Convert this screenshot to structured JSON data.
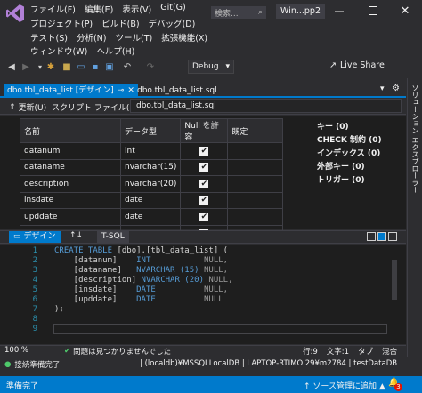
{
  "menu": {
    "row1": [
      "ファイル(F)",
      "編集(E)",
      "表示(V)",
      "Git(G)"
    ],
    "row2": [
      "プロジェクト(P)",
      "ビルド(B)",
      "デバッグ(D)"
    ],
    "row3": [
      "テスト(S)",
      "分析(N)",
      "ツール(T)",
      "拡張機能(X)"
    ],
    "row4": [
      "ウィンドウ(W)",
      "ヘルプ(H)"
    ]
  },
  "search": {
    "placeholder": "検索..."
  },
  "window": {
    "title": "Win...pp2"
  },
  "toolbar": {
    "configuration": "Debug",
    "live_share": "Live Share"
  },
  "tabs": {
    "design_tab": "dbo.tbl_data_list [デザイン]",
    "sql_tab": "dbo.tbl_data_list.sql",
    "right_strip": "ソリューション エクスプローラー"
  },
  "designer": {
    "update_label": "更新(U)",
    "script_file_label": "スクリプト ファイル(I):",
    "script_file_name": "dbo.tbl_data_list.sql"
  },
  "grid": {
    "headers": [
      "名前",
      "データ型",
      "Null を許容",
      "既定"
    ],
    "rows": [
      {
        "name": "datanum",
        "type": "int",
        "nullable": true
      },
      {
        "name": "dataname",
        "type": "nvarchar(15)",
        "nullable": true
      },
      {
        "name": "description",
        "type": "nvarchar(20)",
        "nullable": true
      },
      {
        "name": "insdate",
        "type": "date",
        "nullable": true
      },
      {
        "name": "upddate",
        "type": "date",
        "nullable": true
      },
      {
        "name": "",
        "type": "",
        "nullable": false
      }
    ]
  },
  "properties": [
    "キー (0)",
    "CHECK 制約 (0)",
    "インデックス (0)",
    "外部キー (0)",
    "トリガー (0)"
  ],
  "panes": {
    "design": "デザイン",
    "swap": "↑↓",
    "tsql": "T-SQL"
  },
  "code": {
    "line_numbers": [
      "1",
      "2",
      "3",
      "4",
      "5",
      "6",
      "7",
      "8",
      "9"
    ],
    "line1_kw": "CREATE TABLE",
    "line1_rest": " [dbo].[tbl_data_list] (",
    "line2_col": "    [datanum]    ",
    "line2_type": "INT",
    "line2_null": "           NULL,",
    "line3_col": "    [dataname]   ",
    "line3_type": "NVARCHAR (15)",
    "line3_null": " NULL,",
    "line4_col": "    [description]",
    "line4_type": " NVARCHAR (20)",
    "line4_null": " NULL,",
    "line5_col": "    [insdate]    ",
    "line5_type": "DATE",
    "line5_null": "          NULL,",
    "line6_col": "    [upddate]    ",
    "line6_type": "DATE",
    "line6_null": "          NULL",
    "line7": ");"
  },
  "editor_status": {
    "zoom": "100 %",
    "issues": "問題は見つかりませんでした",
    "line": "行:9",
    "char": "文字:1",
    "tab": "タブ",
    "mixed": "混合"
  },
  "connection": {
    "status": "接続準備完了",
    "info": "| (localdb)¥MSSQLLocalDB  | LAPTOP-RTIMOI29¥m2784  | testDataDB"
  },
  "statusbar": {
    "ready": "準備完了",
    "source_control": "↑ ソース管理に追加 ▲",
    "notifications": "3"
  },
  "colors": {
    "accent": "#007acc",
    "background": "#2d2d30",
    "editor": "#1e1e1e"
  }
}
